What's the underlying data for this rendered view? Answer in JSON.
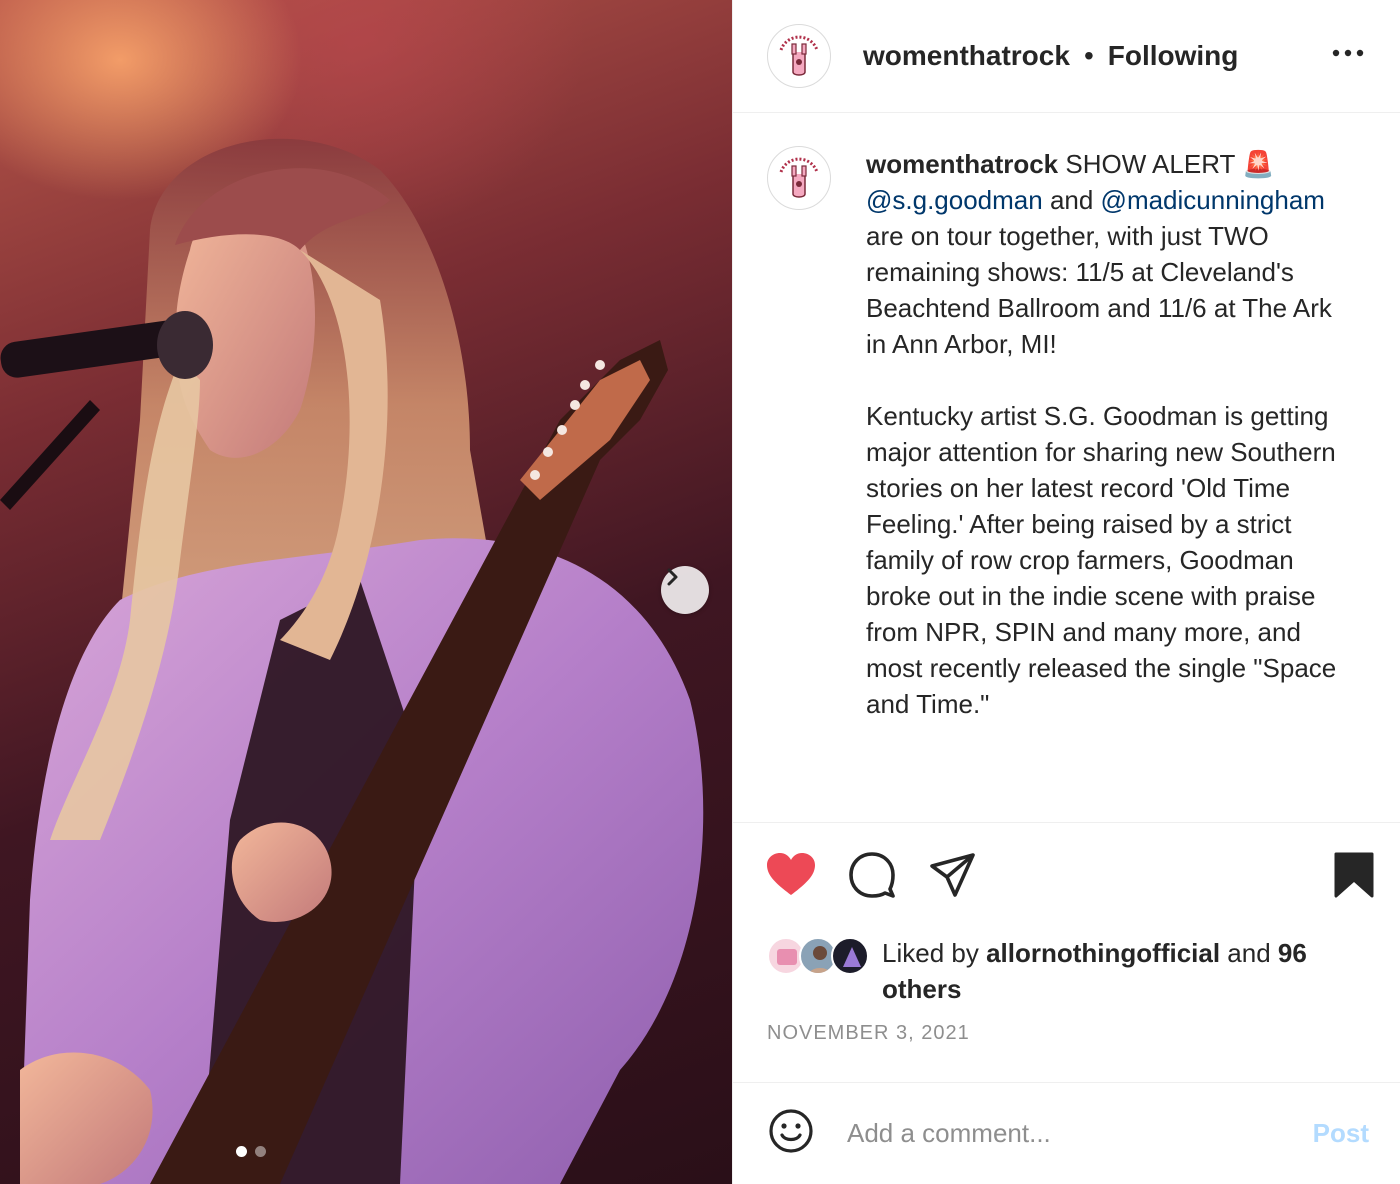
{
  "post": {
    "photo_alt": "",
    "carousel": {
      "total": 2,
      "active": 1
    }
  },
  "header": {
    "username": "womenthatrock",
    "separator": "•",
    "follow_status": "Following",
    "avatar_icon": "womenthatrock-logo-icon",
    "more_icon": "more-options-icon"
  },
  "caption": {
    "username": "womenthatrock",
    "intro": " SHOW ALERT 🚨 ",
    "mention_1": "@s.g.goodman",
    "and_text": " and ",
    "mention_2": "@madicunningham",
    "body": " are on tour together, with just TWO remaining shows: 11/5 at Cleveland's Beachtend Ballroom and 11/6 at The Ark in Ann Arbor, MI!\n\nKentucky artist S.G. Goodman is getting major attention for sharing new Southern stories on her latest record 'Old Time Feeling.' After being raised by a strict family of row crop farmers, Goodman broke out in the indie scene with praise from NPR, SPIN and many more, and most recently released the single \"Space and Time.\""
  },
  "actions": {
    "like_icon": "heart-filled-icon",
    "comment_icon": "comment-icon",
    "share_icon": "share-paper-plane-icon",
    "save_icon": "bookmark-filled-icon",
    "liked": true,
    "saved": true,
    "like_color": "#ed4956"
  },
  "likes": {
    "prefix": "Liked by ",
    "first_liker": "allornothingofficial",
    "middle": " and ",
    "others": "96 others"
  },
  "date": "NOVEMBER 3, 2021",
  "comment": {
    "emoji_icon": "emoji-smiley-icon",
    "placeholder": "Add a comment...",
    "post_label": "Post",
    "post_color": "#b3dbff"
  }
}
